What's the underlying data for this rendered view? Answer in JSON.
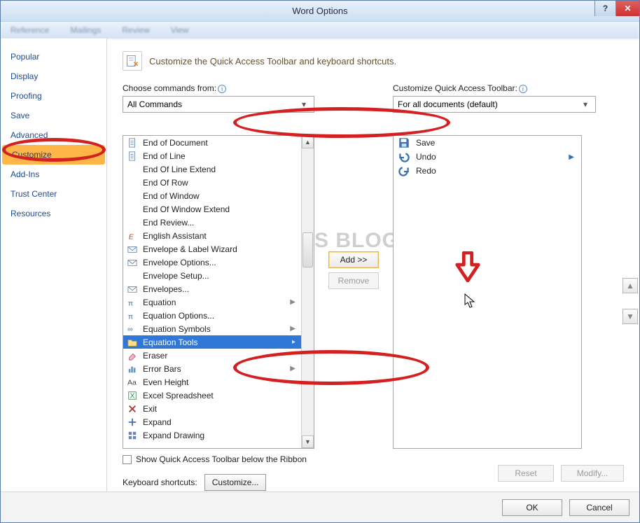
{
  "window": {
    "title": "Word Options"
  },
  "menubar": [
    "Reference",
    "Mailings",
    "Review",
    "View"
  ],
  "sidebar": {
    "items": [
      {
        "label": "Popular"
      },
      {
        "label": "Display"
      },
      {
        "label": "Proofing"
      },
      {
        "label": "Save"
      },
      {
        "label": "Advanced"
      },
      {
        "label": "Customize",
        "selected": true
      },
      {
        "label": "Add-Ins"
      },
      {
        "label": "Trust Center"
      },
      {
        "label": "Resources"
      }
    ]
  },
  "panel": {
    "title": "Customize the Quick Access Toolbar and keyboard shortcuts.",
    "choose_label": "Choose commands from:",
    "choose_value": "All Commands",
    "qat_label": "Customize Quick Access Toolbar:",
    "qat_value": "For all documents (default)",
    "add_label": "Add >>",
    "remove_label": "Remove",
    "reset_label": "Reset",
    "modify_label": "Modify...",
    "show_below": "Show Quick Access Toolbar below the Ribbon",
    "kb_label": "Keyboard shortcuts:",
    "kb_btn": "Customize..."
  },
  "commands": [
    {
      "icon": "page",
      "label": "End of Document"
    },
    {
      "icon": "page",
      "label": "End of Line"
    },
    {
      "icon": "none",
      "label": "End Of Line Extend"
    },
    {
      "icon": "none",
      "label": "End Of Row"
    },
    {
      "icon": "none",
      "label": "End of Window"
    },
    {
      "icon": "none",
      "label": "End Of Window Extend"
    },
    {
      "icon": "none",
      "label": "End Review..."
    },
    {
      "icon": "e",
      "label": "English Assistant"
    },
    {
      "icon": "env",
      "label": "Envelope & Label Wizard"
    },
    {
      "icon": "env",
      "label": "Envelope Options..."
    },
    {
      "icon": "none",
      "label": "Envelope Setup..."
    },
    {
      "icon": "env",
      "label": "Envelopes..."
    },
    {
      "icon": "pi",
      "label": "Equation",
      "sub": "▶"
    },
    {
      "icon": "pi",
      "label": "Equation Options..."
    },
    {
      "icon": "inf",
      "label": "Equation Symbols",
      "sub": "▶"
    },
    {
      "icon": "folder",
      "label": "Equation Tools",
      "sub": "▸",
      "selected": true
    },
    {
      "icon": "eraser",
      "label": "Eraser"
    },
    {
      "icon": "chart",
      "label": "Error Bars",
      "sub": "▶"
    },
    {
      "icon": "aa",
      "label": "Even Height"
    },
    {
      "icon": "xlsx",
      "label": "Excel Spreadsheet"
    },
    {
      "icon": "x",
      "label": "Exit"
    },
    {
      "icon": "plus",
      "label": "Expand"
    },
    {
      "icon": "grid",
      "label": "Expand Drawing"
    }
  ],
  "qat_items": [
    {
      "icon": "save",
      "label": "Save"
    },
    {
      "icon": "undo",
      "label": "Undo",
      "sub": "▶"
    },
    {
      "icon": "redo",
      "label": "Redo"
    }
  ],
  "footer": {
    "ok": "OK",
    "cancel": "Cancel"
  },
  "watermark": "MUHNIUS BLOG"
}
